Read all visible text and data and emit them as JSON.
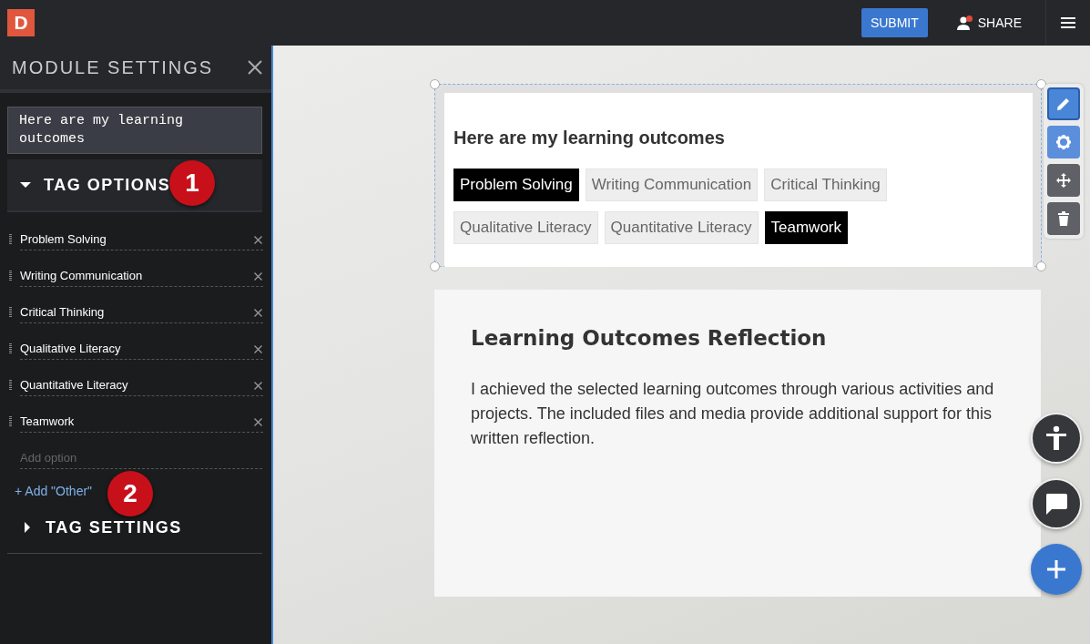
{
  "topbar": {
    "logo": "D",
    "submit": "SUBMIT",
    "share": "SHARE",
    "share_notification": true
  },
  "sidebar": {
    "title": "MODULE SETTINGS",
    "heading_field": {
      "value": "Here are my learning outcomes"
    },
    "tag_options": {
      "label": "TAG OPTIONS",
      "expanded": true,
      "callout": "1",
      "options": [
        {
          "value": "Problem Solving"
        },
        {
          "value": "Writing Communication"
        },
        {
          "value": "Critical Thinking"
        },
        {
          "value": "Qualitative Literacy"
        },
        {
          "value": "Quantitative Literacy"
        },
        {
          "value": "Teamwork"
        }
      ],
      "add_option": {
        "placeholder": "Add option"
      },
      "add_other": "+ Add \"Other\"",
      "add_other_callout": "2"
    },
    "tag_settings": {
      "label": "TAG SETTINGS",
      "expanded": false
    }
  },
  "tags_module": {
    "title": "Here are my learning outcomes",
    "tags": [
      {
        "label": "Problem Solving",
        "selected": true
      },
      {
        "label": "Writing Communication",
        "selected": false
      },
      {
        "label": "Critical Thinking",
        "selected": false
      },
      {
        "label": "Qualitative Literacy",
        "selected": false
      },
      {
        "label": "Quantitative Literacy",
        "selected": false
      },
      {
        "label": "Teamwork",
        "selected": true
      }
    ]
  },
  "reflection": {
    "title": "Learning Outcomes Reflection",
    "body": "I achieved the selected learning outcomes through various activities and projects. The included files and media provide additional support for this written reflection."
  }
}
